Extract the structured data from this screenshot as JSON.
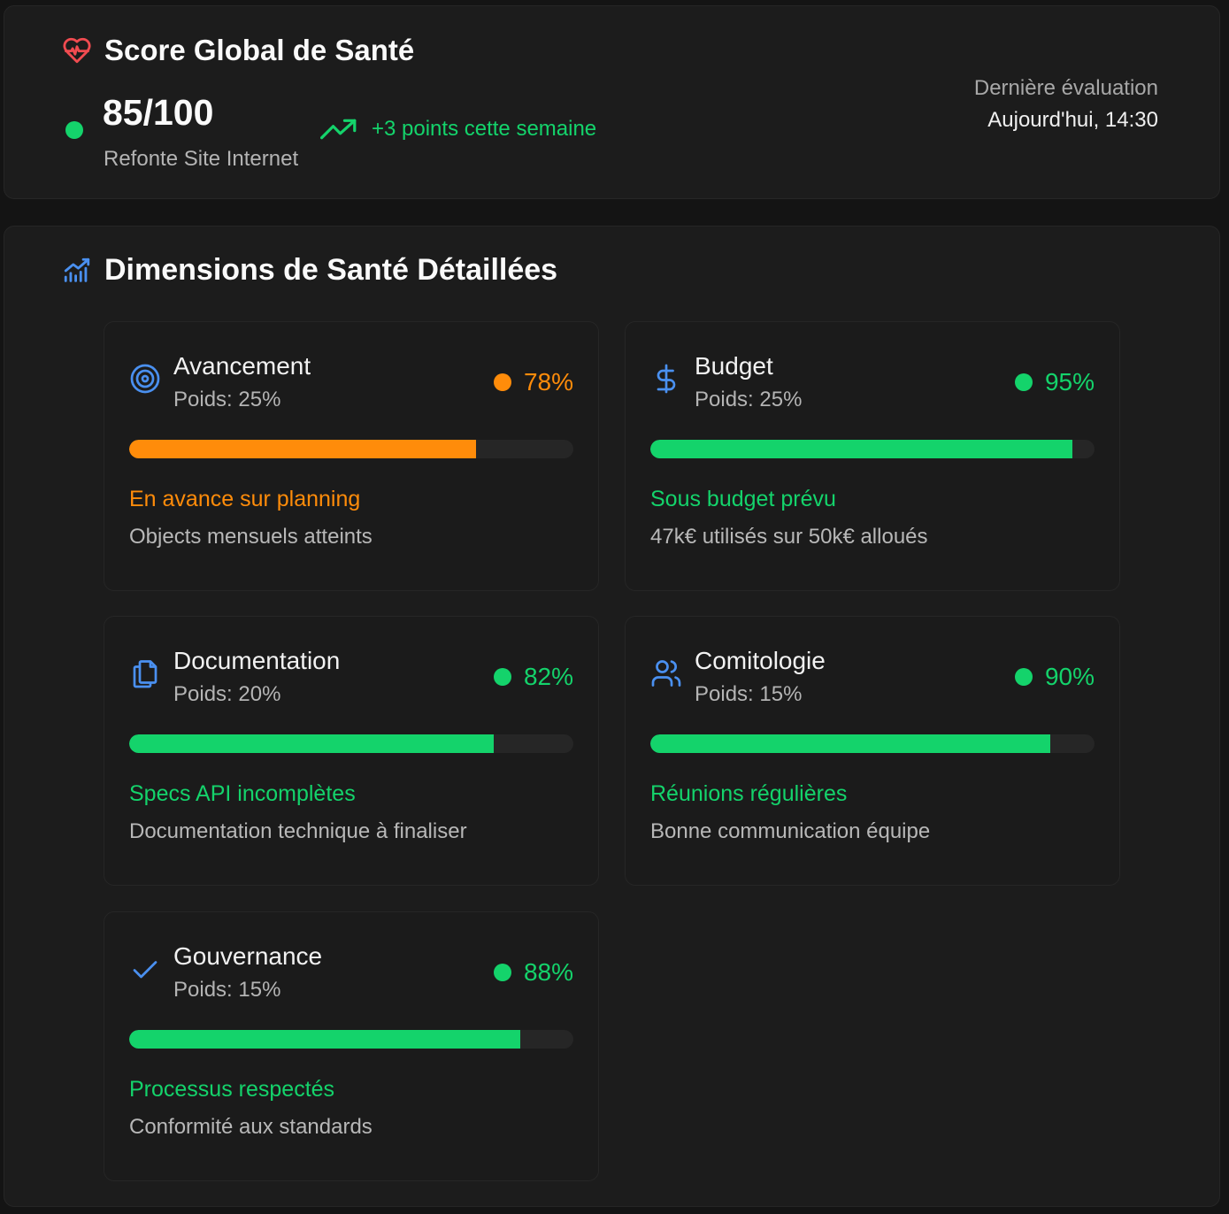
{
  "score_panel": {
    "title": "Score Global de Santé",
    "score": "85/100",
    "project": "Refonte Site Internet",
    "trend": "+3 points cette semaine",
    "last_eval_label": "Dernière évaluation",
    "last_eval_value": "Aujourd'hui, 14:30"
  },
  "dimensions_panel": {
    "title": "Dimensions de Santé Détaillées"
  },
  "colors": {
    "green": "#14d36b",
    "orange": "#ff8c0a",
    "blue_icon": "#4a90f0",
    "red_icon": "#f04b50"
  },
  "cards": [
    {
      "name": "Avancement",
      "weight": "Poids: 25%",
      "score": "78%",
      "progress": 0.78,
      "color": "orange",
      "icon": "target-icon",
      "status": "En avance sur planning",
      "desc": "Objects mensuels atteints"
    },
    {
      "name": "Budget",
      "weight": "Poids: 25%",
      "score": "95%",
      "progress": 0.95,
      "color": "green",
      "icon": "dollar-icon",
      "status": "Sous budget prévu",
      "desc": "47k€ utilisés sur 50k€ alloués"
    },
    {
      "name": "Documentation",
      "weight": "Poids: 20%",
      "score": "82%",
      "progress": 0.82,
      "color": "green",
      "icon": "documents-icon",
      "status": "Specs API incomplètes",
      "desc": "Documentation technique à finaliser"
    },
    {
      "name": "Comitologie",
      "weight": "Poids: 15%",
      "score": "90%",
      "progress": 0.9,
      "color": "green",
      "icon": "users-icon",
      "status": "Réunions régulières",
      "desc": "Bonne communication équipe"
    },
    {
      "name": "Gouvernance",
      "weight": "Poids: 15%",
      "score": "88%",
      "progress": 0.88,
      "color": "green",
      "icon": "check-icon",
      "status": "Processus respectés",
      "desc": "Conformité aux standards"
    }
  ]
}
